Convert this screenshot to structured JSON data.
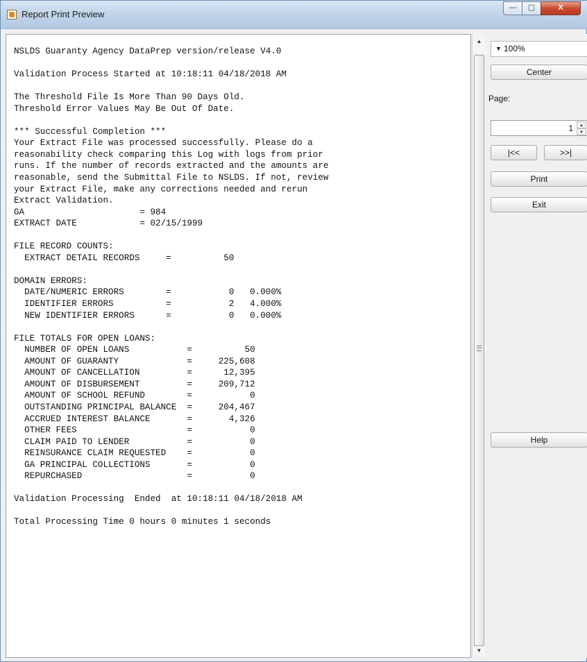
{
  "window": {
    "title": "Report Print Preview"
  },
  "controls": {
    "minimize": "—",
    "maximize": "▢",
    "close": "X"
  },
  "report": {
    "lines": [
      "NSLDS Guaranty Agency DataPrep version/release V4.0",
      "",
      "Validation Process Started at 10:18:11 04/18/2018 AM",
      "",
      "The Threshold File Is More Than 90 Days Old.",
      "Threshold Error Values May Be Out Of Date.",
      "",
      "*** Successful Completion ***",
      "Your Extract File was processed successfully. Please do a",
      "reasonability check comparing this Log with logs from prior",
      "runs. If the number of records extracted and the amounts are",
      "reasonable, send the Submittal File to NSLDS. If not, review",
      "your Extract File, make any corrections needed and rerun",
      "Extract Validation.",
      "GA                      = 984",
      "EXTRACT DATE            = 02/15/1999",
      "",
      "FILE RECORD COUNTS:",
      "  EXTRACT DETAIL RECORDS     =          50",
      "",
      "DOMAIN ERRORS:",
      "  DATE/NUMERIC ERRORS        =           0   0.000%",
      "  IDENTIFIER ERRORS          =           2   4.000%",
      "  NEW IDENTIFIER ERRORS      =           0   0.000%",
      "",
      "FILE TOTALS FOR OPEN LOANS:",
      "  NUMBER OF OPEN LOANS           =          50",
      "  AMOUNT OF GUARANTY             =     225,608",
      "  AMOUNT OF CANCELLATION         =      12,395",
      "  AMOUNT OF DISBURSEMENT         =     209,712",
      "  AMOUNT OF SCHOOL REFUND        =           0",
      "  OUTSTANDING PRINCIPAL BALANCE  =     204,467",
      "  ACCRUED INTEREST BALANCE       =       4,326",
      "  OTHER FEES                     =           0",
      "  CLAIM PAID TO LENDER           =           0",
      "  REINSURANCE CLAIM REQUESTED    =           0",
      "  GA PRINCIPAL COLLECTIONS       =           0",
      "  REPURCHASED                    =           0",
      "",
      "Validation Processing  Ended  at 10:18:11 04/18/2018 AM",
      "",
      "Total Processing Time 0 hours 0 minutes 1 seconds"
    ]
  },
  "sidebar": {
    "zoom": "100%",
    "center_label": "Center",
    "page_label": "Page:",
    "page_value": "1",
    "first_label": "|<<",
    "last_label": ">>|",
    "print_label": "Print",
    "exit_label": "Exit",
    "help_label": "Help"
  },
  "icons": {
    "dropdown": "▼",
    "scroll_up": "▲",
    "scroll_down": "▼",
    "spin_up": "▲",
    "spin_down": "▼"
  }
}
